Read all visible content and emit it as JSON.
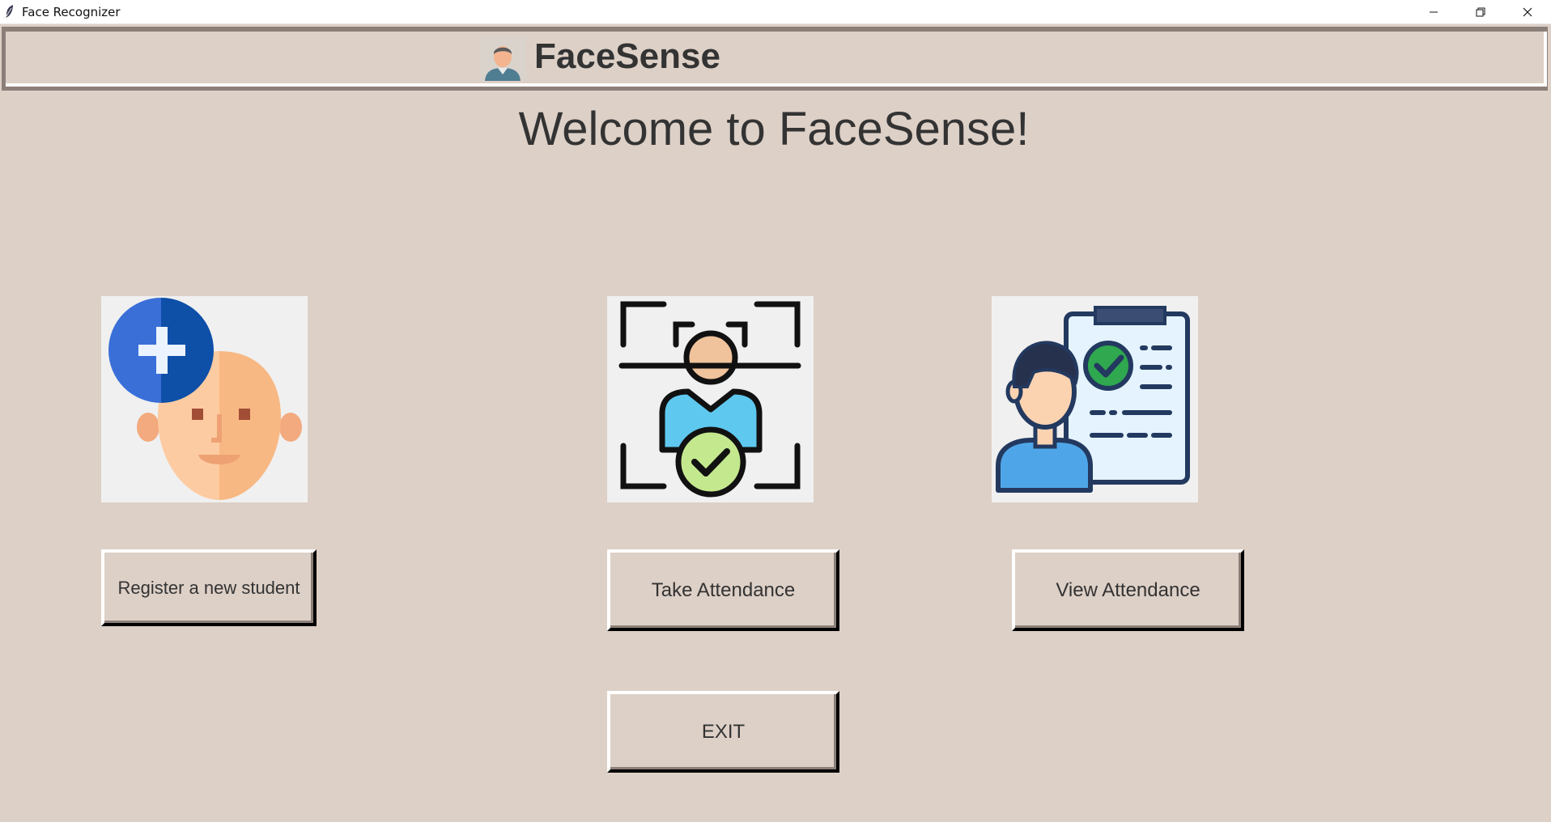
{
  "window": {
    "title": "Face Recognizer",
    "controls": {
      "minimize": "minimize-icon",
      "restore": "restore-icon",
      "close": "close-icon"
    }
  },
  "header": {
    "brand": "FaceSense",
    "icon": "user-avatar-icon"
  },
  "welcome": "Welcome to FaceSense!",
  "cards": [
    {
      "icon": "add-face-icon",
      "label": "Register a new student"
    },
    {
      "icon": "face-scan-check-icon",
      "label": "Take Attendance"
    },
    {
      "icon": "clipboard-user-icon",
      "label": "View Attendance"
    }
  ],
  "exit_label": "EXIT",
  "colors": {
    "background": "#ddd0c7",
    "bevel_dark": "#8b8079",
    "text": "#333333",
    "tile": "#f0f0f0"
  }
}
